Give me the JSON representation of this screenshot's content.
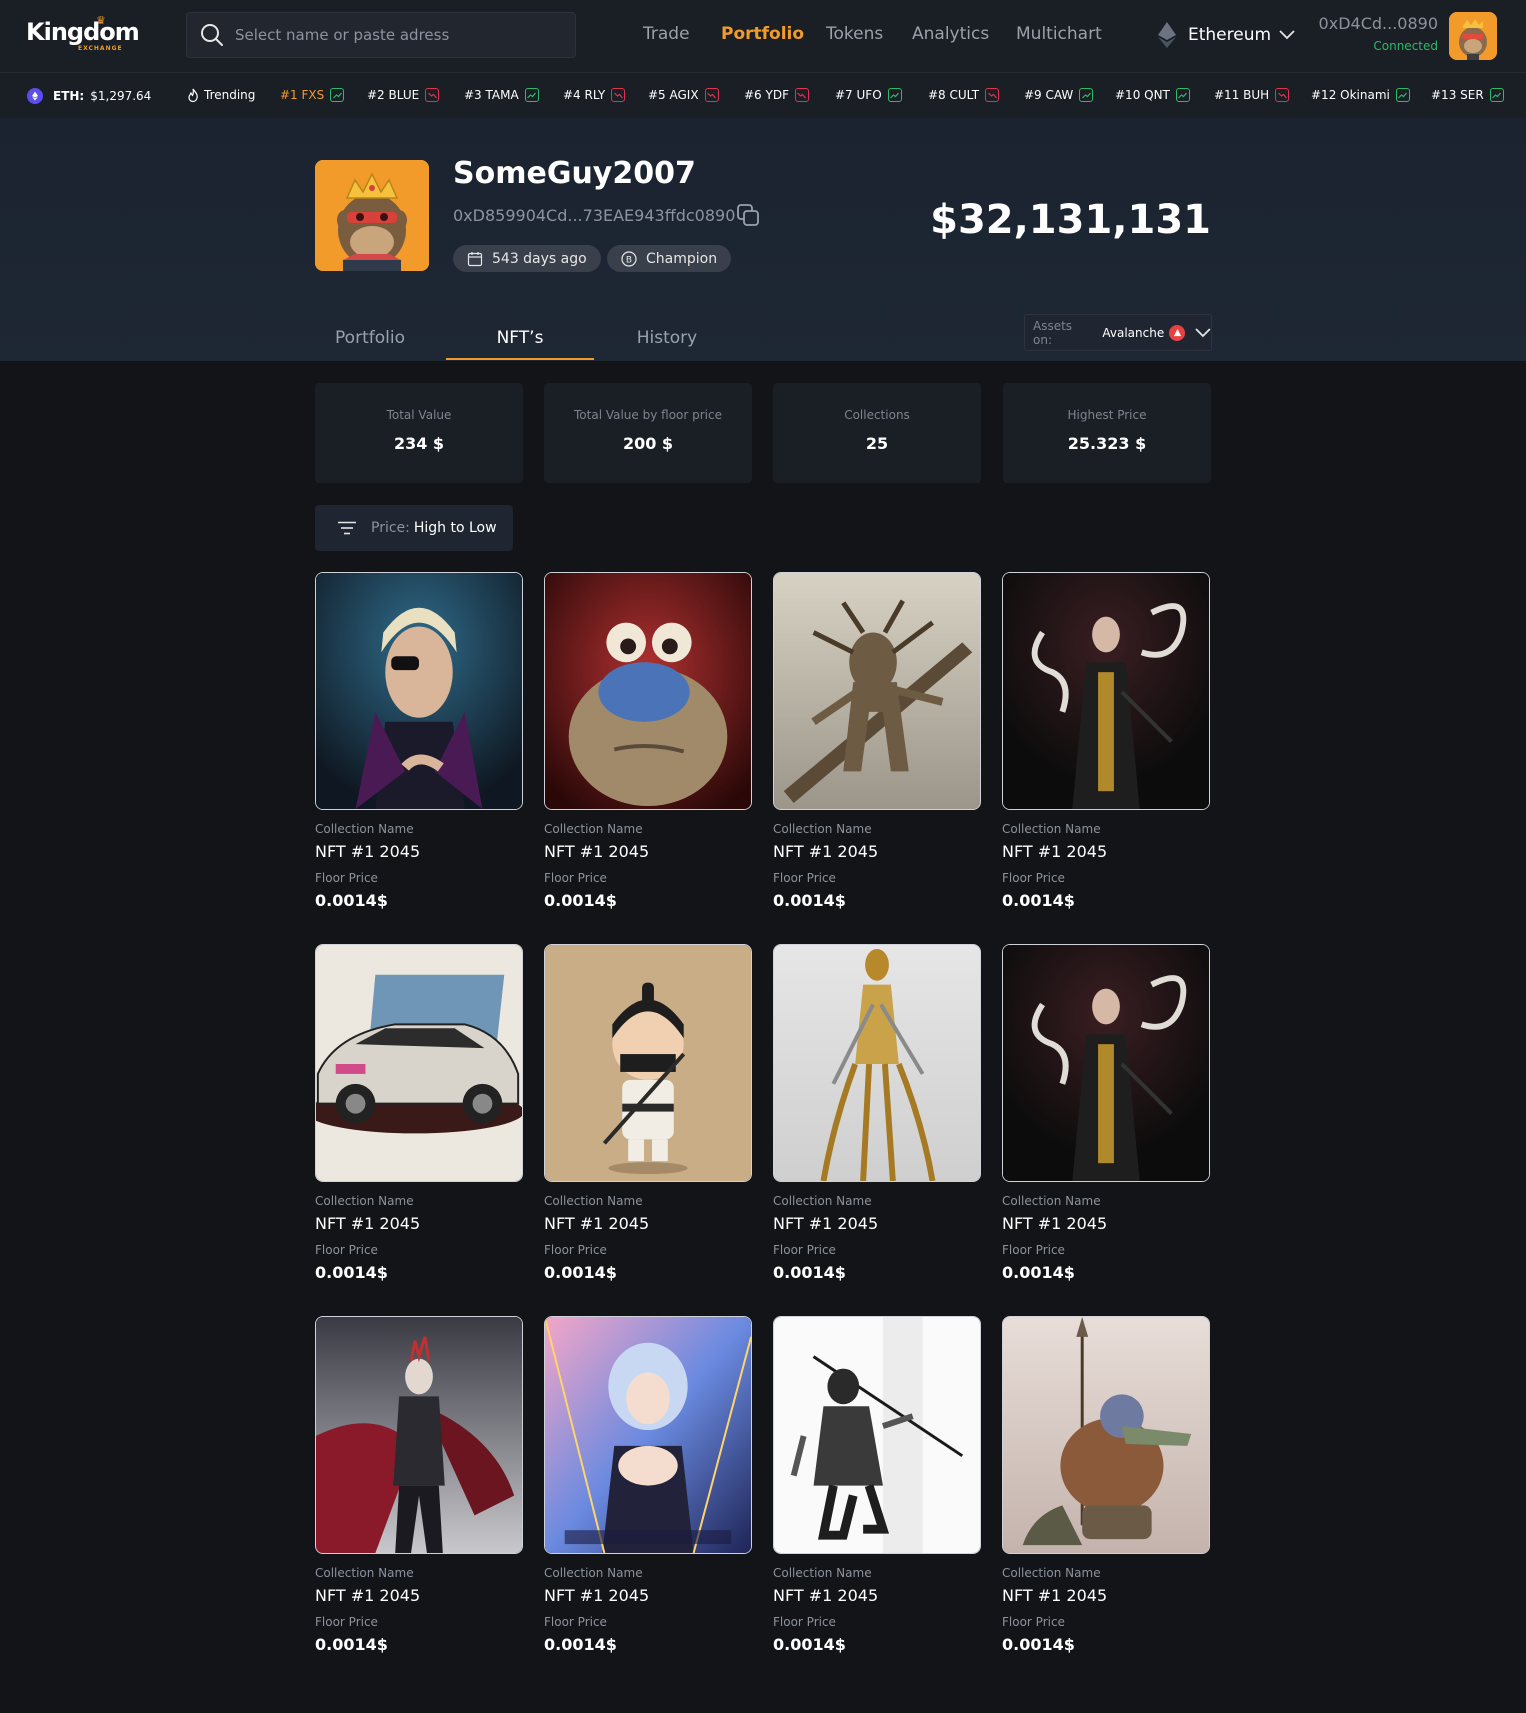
{
  "header": {
    "logo_text": "Kingdom",
    "logo_subtext": "EXCHANGE",
    "search_placeholder": "Select name or paste adress",
    "nav": [
      {
        "label": "Trade",
        "active": false
      },
      {
        "label": "Portfolio",
        "active": true
      },
      {
        "label": "Tokens",
        "active": false
      },
      {
        "label": "Analytics",
        "active": false
      },
      {
        "label": "Multichart",
        "active": false
      }
    ],
    "network": "Ethereum",
    "wallet_address": "0xD4Cd...0890",
    "wallet_status": "Connected"
  },
  "ticker": {
    "eth_label": "ETH:",
    "eth_price": "$1,297.64",
    "trending_label": "Trending",
    "items": [
      {
        "label": "#1 FXS",
        "trend": "up"
      },
      {
        "label": "#2 BLUE",
        "trend": "down"
      },
      {
        "label": "#3 TAMA",
        "trend": "up"
      },
      {
        "label": "#4 RLY",
        "trend": "down"
      },
      {
        "label": "#5 AGIX",
        "trend": "down"
      },
      {
        "label": "#6 YDF",
        "trend": "down"
      },
      {
        "label": "#7 UFO",
        "trend": "up"
      },
      {
        "label": "#8 CULT",
        "trend": "down"
      },
      {
        "label": "#9 CAW",
        "trend": "up"
      },
      {
        "label": "#10 QNT",
        "trend": "up"
      },
      {
        "label": "#11 BUH",
        "trend": "down"
      },
      {
        "label": "#12 Okinami",
        "trend": "up"
      },
      {
        "label": "#13 SER",
        "trend": "up"
      }
    ]
  },
  "profile": {
    "username": "SomeGuy2007",
    "address": "0xD859904Cd...73EAE943ffdc0890",
    "age_badge": "543 days ago",
    "rank_badge": "Champion",
    "balance": "$32,131,131"
  },
  "tabs": [
    {
      "label": "Portfolio",
      "active": false
    },
    {
      "label": "NFT’s",
      "active": true
    },
    {
      "label": "History",
      "active": false
    }
  ],
  "assets_on": {
    "label": "Assets on:",
    "value": "Avalanche"
  },
  "stats": [
    {
      "title": "Total Value",
      "value": "234 $"
    },
    {
      "title": "Total Value by floor price",
      "value": "200 $"
    },
    {
      "title": "Collections",
      "value": "25"
    },
    {
      "title": "Highest Price",
      "value": "25.323 $"
    }
  ],
  "sort": {
    "label": "Price:",
    "value": "High to Low"
  },
  "nfts": [
    {
      "collection": "Collection Name",
      "name": "NFT #1 2045",
      "floor_label": "Floor Price",
      "floor_price": "0.0014$"
    },
    {
      "collection": "Collection Name",
      "name": "NFT #1 2045",
      "floor_label": "Floor Price",
      "floor_price": "0.0014$"
    },
    {
      "collection": "Collection Name",
      "name": "NFT #1 2045",
      "floor_label": "Floor Price",
      "floor_price": "0.0014$"
    },
    {
      "collection": "Collection Name",
      "name": "NFT #1 2045",
      "floor_label": "Floor Price",
      "floor_price": "0.0014$"
    },
    {
      "collection": "Collection Name",
      "name": "NFT #1 2045",
      "floor_label": "Floor Price",
      "floor_price": "0.0014$"
    },
    {
      "collection": "Collection Name",
      "name": "NFT #1 2045",
      "floor_label": "Floor Price",
      "floor_price": "0.0014$"
    },
    {
      "collection": "Collection Name",
      "name": "NFT #1 2045",
      "floor_label": "Floor Price",
      "floor_price": "0.0014$"
    },
    {
      "collection": "Collection Name",
      "name": "NFT #1 2045",
      "floor_label": "Floor Price",
      "floor_price": "0.0014$"
    },
    {
      "collection": "Collection Name",
      "name": "NFT #1 2045",
      "floor_label": "Floor Price",
      "floor_price": "0.0014$"
    },
    {
      "collection": "Collection Name",
      "name": "NFT #1 2045",
      "floor_label": "Floor Price",
      "floor_price": "0.0014$"
    },
    {
      "collection": "Collection Name",
      "name": "NFT #1 2045",
      "floor_label": "Floor Price",
      "floor_price": "0.0014$"
    },
    {
      "collection": "Collection Name",
      "name": "NFT #1 2045",
      "floor_label": "Floor Price",
      "floor_price": "0.0014$"
    }
  ],
  "colors": {
    "accent": "#f29b2b",
    "up": "#2dbb66",
    "down": "#e0334d",
    "background": "#121417",
    "panel": "#1a1e25"
  }
}
